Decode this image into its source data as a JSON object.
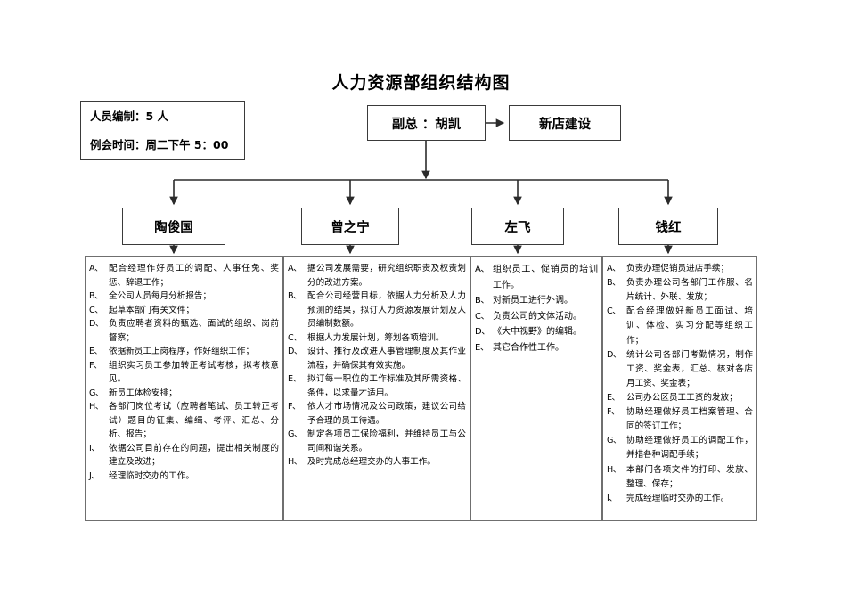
{
  "title": "人力资源部组织结构图",
  "info_box": {
    "name": "人员编制与例会信息",
    "lines": [
      "人员编制：5 人",
      "例会时间：周二下午 5：00"
    ]
  },
  "executive": {
    "vp_label": "副总 ：胡凯",
    "new_store_label": "新店建设"
  },
  "managers": [
    {
      "name": "陶俊国"
    },
    {
      "name": "曾之宁"
    },
    {
      "name": "左飞"
    },
    {
      "name": "钱红"
    }
  ],
  "duties": [
    {
      "owner": "陶俊国",
      "items": [
        {
          "marker": "A、",
          "text": "配合经理作好员工的调配、人事任免、奖惩、辞退工作；"
        },
        {
          "marker": "B、",
          "text": "全公司人员每月分析报告；"
        },
        {
          "marker": "C、",
          "text": "起草本部门有关文件；"
        },
        {
          "marker": "D、",
          "text": "负责应聘者资料的甄选、面试的组织、岗前督察；"
        },
        {
          "marker": "E、",
          "text": "依据新员工上岗程序，作好组织工作；"
        },
        {
          "marker": "F、",
          "text": "组织实习员工参加转正考试考核，拟考核意见。"
        },
        {
          "marker": "G、",
          "text": "新员工体检安排；"
        },
        {
          "marker": "H、",
          "text": "各部门岗位考试（应聘者笔试、员工转正考试）题目的征集、编缉、考评、汇总、分析、报告；"
        },
        {
          "marker": "I、",
          "text": "依据公司目前存在的问题，提出相关制度的建立及改进；"
        },
        {
          "marker": "J、",
          "text": "经理临时交办的工作。"
        }
      ]
    },
    {
      "owner": "曾之宁",
      "items": [
        {
          "marker": "A、",
          "text": "据公司发展需要，研究组织职责及权责划分的改进方案。"
        },
        {
          "marker": "B、",
          "text": "配合公司经营目标，依据人力分析及人力预测的结果，拟订人力资源发展计划及人员编制数额。"
        },
        {
          "marker": "C、",
          "text": "根据人力发展计划，筹划各项培训。"
        },
        {
          "marker": "D、",
          "text": "设计、推行及改进人事管理制度及其作业流程，并确保其有效实施。"
        },
        {
          "marker": "E、",
          "text": "拟订每一职位的工作标准及其所需资格、条件，以求量才适用。"
        },
        {
          "marker": "F、",
          "text": "依人才市场情况及公司政策，建议公司给予合理的员工待遇。"
        },
        {
          "marker": "G、",
          "text": "制定各项员工保险福利，并维持员工与公司间和谐关系。"
        },
        {
          "marker": "H、",
          "text": "及时完成总经理交办的人事工作。"
        }
      ]
    },
    {
      "owner": "左飞",
      "items": [
        {
          "marker": "A、",
          "text": "组织员工、促销员的培训工作。"
        },
        {
          "marker": "B、",
          "text": "对新员工进行外调。"
        },
        {
          "marker": "C、",
          "text": "负责公司的文体活动。"
        },
        {
          "marker": "D、",
          "text": "《大中视野》的编辑。"
        },
        {
          "marker": "E、",
          "text": "其它合作性工作。"
        }
      ]
    },
    {
      "owner": "钱红",
      "items": [
        {
          "marker": "A、",
          "text": "负责办理促销员进店手续；"
        },
        {
          "marker": "B、",
          "text": "负责办理公司各部门工作服、名片统计、外联、发放；"
        },
        {
          "marker": "C、",
          "text": "配合经理做好新员工面试、培训、体检、实习分配等组织工作；"
        },
        {
          "marker": "D、",
          "text": "统计公司各部门考勤情况，制作工资、奖金表，汇总、核对各店月工资、奖金表；"
        },
        {
          "marker": "E、",
          "text": "公司办公区员工工资的发放；"
        },
        {
          "marker": "F、",
          "text": "协助经理做好员工档案管理、合同的签订工作；"
        },
        {
          "marker": "G、",
          "text": "协助经理做好员工的调配工作，并措各种调配手续；"
        },
        {
          "marker": "H、",
          "text": "本部门各项文件的打印、发放、整理、保存；"
        },
        {
          "marker": "I、",
          "text": "完成经理临时交办的工作。"
        }
      ]
    }
  ],
  "colors": {
    "line": "#2b2b2b",
    "box_border": "#3a3a3a",
    "detail_border": "#6f6f6f",
    "text": "#000000",
    "background": "#ffffff"
  }
}
